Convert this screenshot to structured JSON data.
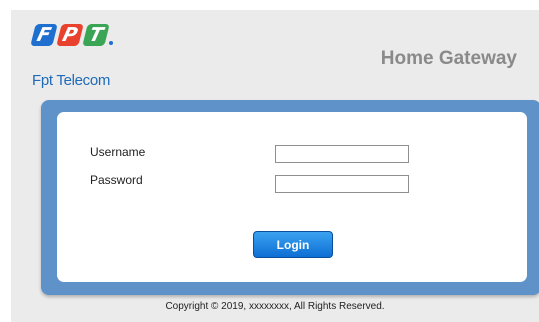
{
  "header": {
    "logo_letters": [
      "F",
      "P",
      "T"
    ],
    "brand_name": "Fpt Telecom",
    "product_title": "Home Gateway"
  },
  "login": {
    "username_label": "Username",
    "password_label": "Password",
    "username_value": "",
    "password_value": "",
    "login_button": "Login"
  },
  "footer": {
    "copyright": "Copyright © 2019, xxxxxxxx, All Rights Reserved."
  },
  "colors": {
    "brand_blue": "#1e6bb8",
    "panel_blue": "#5f92c9",
    "button_blue": "#0d6fd4",
    "logo_red": "#e8422e",
    "logo_green": "#3aa655"
  }
}
